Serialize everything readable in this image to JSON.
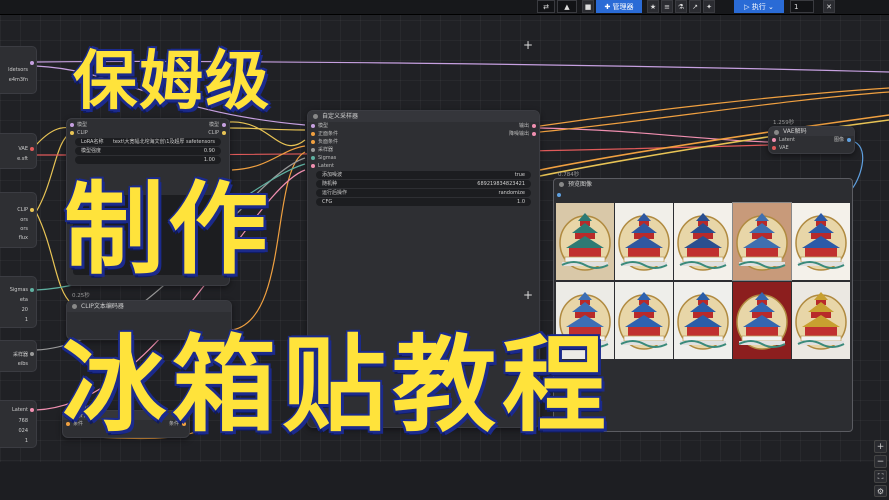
{
  "toolbar": {
    "translate_icon": "translate-icon",
    "manager_label": "管理器",
    "run_label": "执行",
    "run_count": "1"
  },
  "overlay": {
    "line1": "保姆级",
    "line2": "制作",
    "line3": "冰箱贴教程"
  },
  "left_nodes": {
    "model_row1": "ldetsors",
    "model_row2": "e4m3fn",
    "vae_label": "VAE",
    "vae_value": "e.sft",
    "clip_label": "CLIP",
    "clip_row1": "ors",
    "clip_row2": "ors",
    "clip_row3": "flux",
    "sigmas_label": "Sigmas",
    "sigmas_row1": "eta",
    "sigmas_row2": "20",
    "sigmas_row3": "1",
    "sampler_label": "采样器",
    "sampler_value": "eibs",
    "latent_label": "Latent",
    "latent_row1": "768",
    "latent_row2": "024",
    "latent_row3": "1"
  },
  "lora_node": {
    "header_in1": "模型",
    "header_in2": "CLIP",
    "header_out1": "模型",
    "header_out2": "CLIP",
    "lora_name_label": "LoRA名称",
    "lora_name_value": "text\\大宽幅北坨海文创\\1及超厚 safetensors",
    "strength_label": "模型强度",
    "strength_value": "0.90",
    "clip_strength_value": "1.00",
    "node_id": "0.25秒",
    "clip_encoder_title": "CLIP文本编码器",
    "encoder_text_1": "ill ext",
    "encoder_text_2": "ol",
    "encoder_text_3": "oa"
  },
  "sampler_node": {
    "title": "自定义采样器",
    "in_model": "模型",
    "in_positive": "正面条件",
    "in_negative": "负面条件",
    "in_sampler": "采样器",
    "in_sigmas": "Sigmas",
    "in_latent": "Latent",
    "out_output": "输出",
    "out_denoised": "降噪输出",
    "add_noise_label": "添加噪波",
    "add_noise_value": "true",
    "seed_label": "随机种",
    "seed_value": "689219834823421",
    "control_label": "运行后操作",
    "control_value": "randomize",
    "cfg_label": "CFG",
    "cfg_value": "1.0"
  },
  "vae_node": {
    "node_id": "1.259秒",
    "title": "VAE解码",
    "in_latent": "Latent",
    "in_vae": "VAE",
    "out_image": "图像"
  },
  "preview_node": {
    "node_id": "0.784秒",
    "title": "预览图像"
  },
  "bottom_node": {
    "node_id": "0.25秒",
    "title": "条件零化",
    "in_cond": "条件",
    "out_cond": "条件"
  },
  "colors": {
    "overlay_fill": "#ffe33b",
    "overlay_stroke": "#1b2a8c",
    "accent": "#2a6bd6"
  }
}
